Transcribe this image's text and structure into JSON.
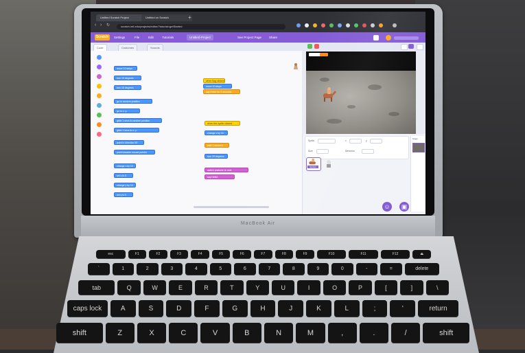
{
  "browser": {
    "tabs": [
      "Untitled Scratch Project",
      "Untitled on Scratch"
    ],
    "url": "scratch.mit.edu/projects/editor/?tutorial=getStarted"
  },
  "scratch": {
    "logo": "Scratch",
    "menu": [
      "Settings",
      "File",
      "Edit",
      "Tutorials",
      "Untitled-Project",
      "See Project Page",
      "Share"
    ],
    "editor_tabs": [
      "Code",
      "Costumes",
      "Sounds"
    ],
    "palette_blocks": [
      "move 10 steps",
      "turn 15 degrees",
      "turn 15 degrees",
      "go to random position",
      "go to x: y:",
      "glide 1 secs to random position",
      "glide 1 secs to x: y:",
      "point in direction 90",
      "point towards mouse-pointer",
      "change x by 10",
      "set x to 0",
      "change y by 10",
      "set y to 0"
    ],
    "script_blocks": {
      "script1": [
        "when flag clicked",
        "move 10 steps",
        "say Hello! for 2 seconds"
      ],
      "script2": [
        "when this sprite clicked",
        "change x by 10",
        "wait 1 seconds",
        "turn 15 degrees",
        "switch costume to next",
        "say Hello!"
      ]
    },
    "sprite_info": {
      "sprite_label": "Sprite",
      "x_label": "x",
      "y_label": "y",
      "size_label": "Size",
      "direction_label": "Direction"
    },
    "sprite_name": "Sprite1",
    "stage_label": "Stage"
  },
  "laptop": {
    "brand": "MacBook Air"
  },
  "keyboard": {
    "row1": [
      "esc",
      "F1",
      "F2",
      "F3",
      "F4",
      "F5",
      "F6",
      "F7",
      "F8",
      "F9",
      "F10",
      "F11",
      "F12",
      "⏏"
    ],
    "row2": [
      "`",
      "1",
      "2",
      "3",
      "4",
      "5",
      "6",
      "7",
      "8",
      "9",
      "0",
      "-",
      "=",
      "delete"
    ],
    "row3": [
      "tab",
      "Q",
      "W",
      "E",
      "R",
      "T",
      "Y",
      "U",
      "I",
      "O",
      "P",
      "[",
      "]",
      "\\"
    ],
    "row4": [
      "caps lock",
      "A",
      "S",
      "D",
      "F",
      "G",
      "H",
      "J",
      "K",
      "L",
      ";",
      "'",
      "return"
    ],
    "row5": [
      "shift",
      "Z",
      "X",
      "C",
      "V",
      "B",
      "N",
      "M",
      ",",
      ".",
      "/",
      "shift"
    ]
  },
  "colors": {
    "scratch_purple": "#855cd6",
    "motion_blue": "#4c97ff",
    "events_yellow": "#ffab19",
    "looks_purple": "#cf63cf"
  }
}
